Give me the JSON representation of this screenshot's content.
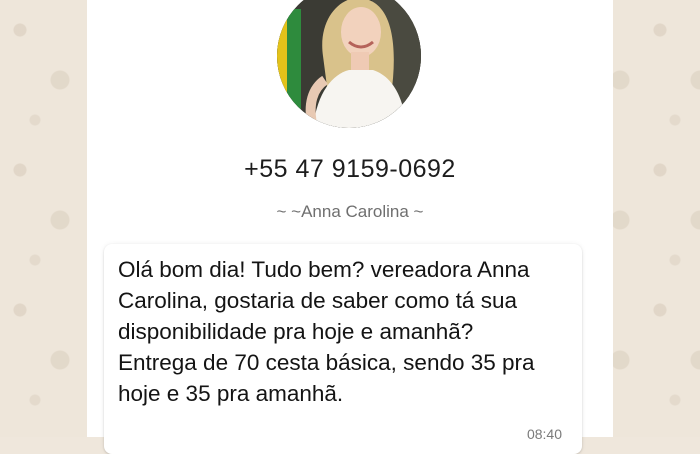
{
  "contact": {
    "avatar_alt": "profile-photo",
    "phone": "+55 47 9159-0692",
    "name": "~ ~Anna Carolina ~"
  },
  "message": {
    "text": "Olá bom dia! Tudo bem? vereadora Anna Carolina, gostaria de saber como tá sua disponibilidade pra hoje e amanhã? Entrega de 70 cesta básica, sendo 35 pra hoje e 35 pra amanhã.",
    "time": "08:40"
  },
  "colors": {
    "wallpaper": "#eee6da",
    "card": "#ffffff",
    "avatar_accent_green": "#2e8b3d",
    "avatar_accent_yellow": "#e3c21a"
  }
}
